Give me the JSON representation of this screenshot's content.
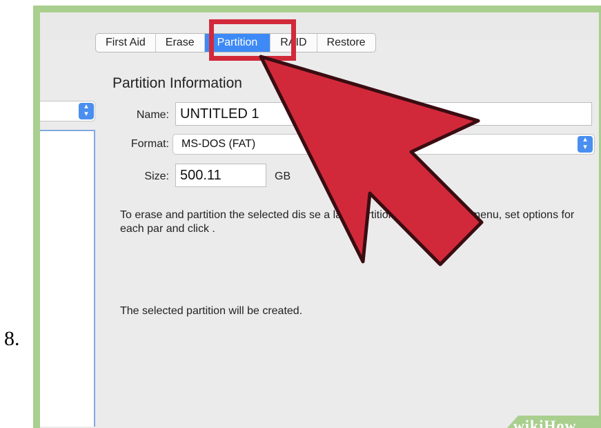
{
  "step_number": "8.",
  "tabs": [
    {
      "label": "First Aid",
      "active": false
    },
    {
      "label": "Erase",
      "active": false
    },
    {
      "label": "Partition",
      "active": true
    },
    {
      "label": "RAID",
      "active": false
    },
    {
      "label": "Restore",
      "active": false
    }
  ],
  "partition_info": {
    "title": "Partition Information",
    "name_label": "Name:",
    "name_value": "UNTITLED 1",
    "format_label": "Format:",
    "format_value": "MS-DOS (FAT)",
    "size_label": "Size:",
    "size_value": "500.11",
    "size_unit": "GB"
  },
  "description": "To erase and partition the selected dis              se a la               e Partition Layout pop-up menu, set options for each par          and click .",
  "status_text": "The selected partition will be created.",
  "watermark": {
    "wiki": "wiki",
    "how": "How"
  },
  "colors": {
    "highlight": "#d2293a",
    "arrow": "#d2293a",
    "accent": "#3d8af7",
    "frame": "#a9cf8e"
  },
  "icons": {
    "stepper": "up-down-chevron-icon",
    "pointer": "red-arrow-pointer"
  }
}
